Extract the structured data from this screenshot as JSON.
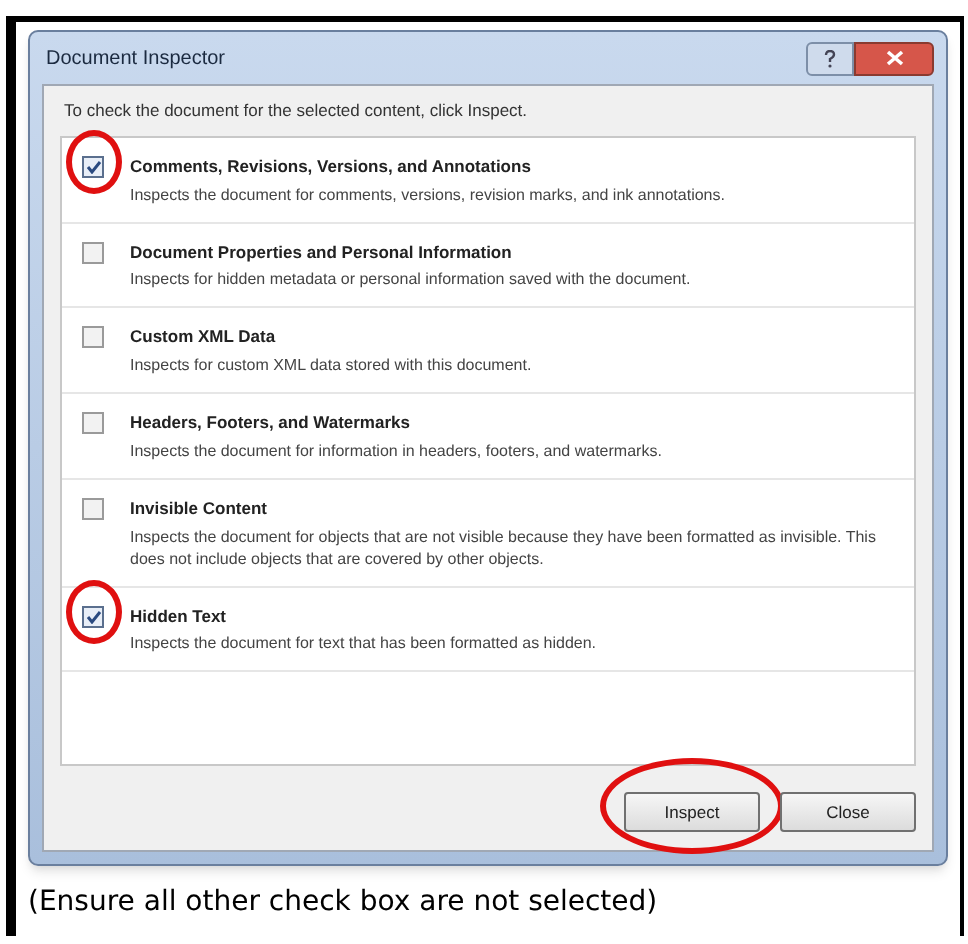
{
  "window": {
    "title": "Document Inspector"
  },
  "instruction": "To check the document for the selected content, click Inspect.",
  "items": [
    {
      "title": "Comments, Revisions, Versions, and Annotations",
      "description": "Inspects the document for comments, versions, revision marks, and ink annotations.",
      "checked": true,
      "circled": true
    },
    {
      "title": "Document Properties and Personal Information",
      "description": "Inspects for hidden metadata or personal information saved with the document.",
      "checked": false,
      "circled": false
    },
    {
      "title": "Custom XML Data",
      "description": "Inspects for custom XML data stored with this document.",
      "checked": false,
      "circled": false
    },
    {
      "title": "Headers, Footers, and Watermarks",
      "description": "Inspects the document for information in headers, footers, and watermarks.",
      "checked": false,
      "circled": false
    },
    {
      "title": "Invisible Content",
      "description": "Inspects the document for objects that are not visible because they have been formatted as invisible. This does not include objects that are covered by other objects.",
      "checked": false,
      "circled": false
    },
    {
      "title": "Hidden Text",
      "description": "Inspects the document for text that has been formatted as hidden.",
      "checked": true,
      "circled": true
    }
  ],
  "buttons": [
    {
      "label": "Inspect",
      "circled": true
    },
    {
      "label": "Close",
      "circled": false
    }
  ],
  "caption": "(Ensure all other check box are not selected)"
}
